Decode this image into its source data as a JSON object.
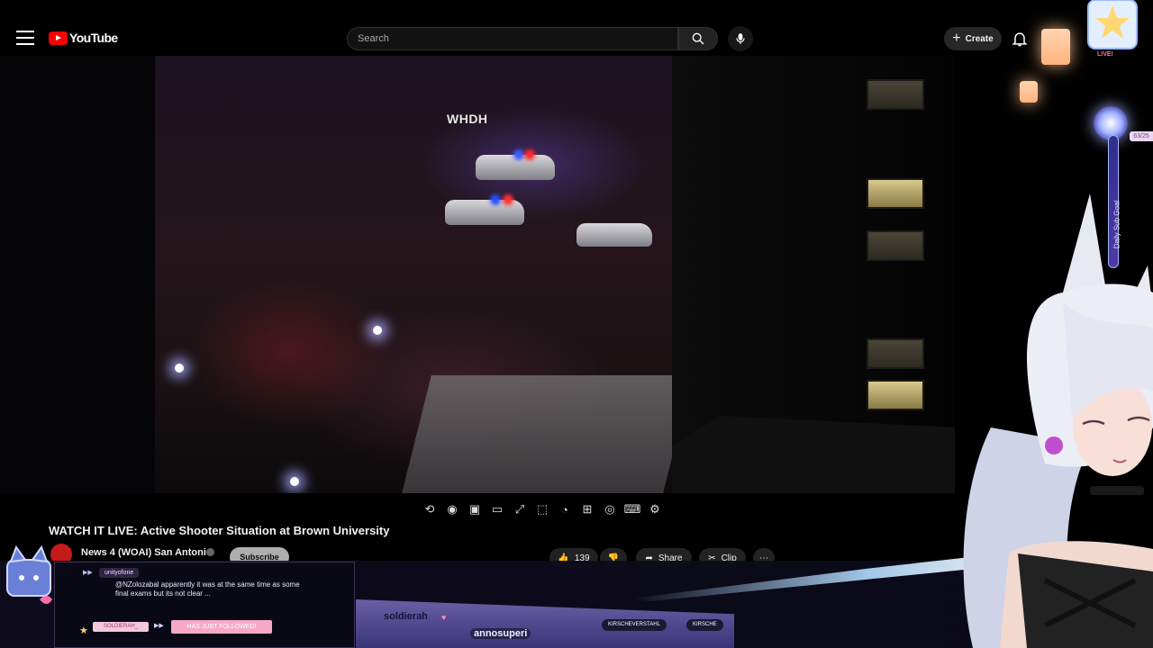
{
  "header": {
    "brand": "YouTube",
    "search_placeholder": "Search",
    "create_label": "Create"
  },
  "video": {
    "watermark": "WHDH",
    "title": "WATCH IT LIVE: Active Shooter Situation at Brown University",
    "channel_name": "News 4 (WOAI) San Antonio",
    "subscribe_label": "Subscribe",
    "like_count": "139",
    "share_label": "Share",
    "clip_label": "Clip"
  },
  "toolbar": {
    "icons": [
      "loop-icon",
      "live-icon",
      "mini-settings-icon",
      "theater-icon",
      "fullscreen-icon",
      "crop-icon",
      "speed-icon",
      "add-icon",
      "screenshot-icon",
      "keyboard-icon",
      "gear-icon"
    ]
  },
  "stream_overlay": {
    "chat_username": "unityofone",
    "chat_message": "@NZolozabal apparently it was at the same time as some final exams but its not clear ...",
    "follower_name": "SOLDIERAH_",
    "follow_text": "HAS JUST FOLLOWED!",
    "sub_name_1": "soldierah",
    "sub_name_2": "annosuperi",
    "twitter_handle": "KIRSCHEVERSTAHL",
    "chat_handle": "KIRSCHE",
    "live_tag": "LIVE!",
    "goal_label": "Daily Sub Goal",
    "goal_count": "63/25"
  },
  "colors": {
    "brand_red": "#ff0000",
    "background": "#000000",
    "accent_pink": "#f6a9c7",
    "goal_blue": "#4d3aa3"
  }
}
